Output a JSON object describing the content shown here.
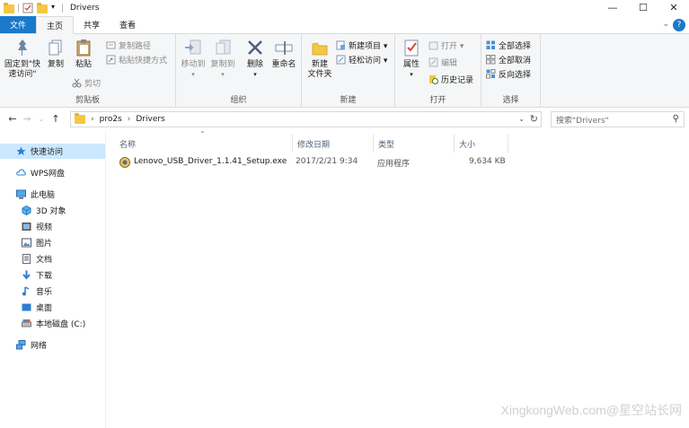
{
  "window": {
    "title": "Drivers",
    "controls": {
      "minimize": "—",
      "maximize": "☐",
      "close": "✕"
    }
  },
  "tabs": [
    {
      "label": "文件",
      "kind": "file"
    },
    {
      "label": "主页",
      "kind": "active"
    },
    {
      "label": "共享",
      "kind": "normal"
    },
    {
      "label": "查看",
      "kind": "normal"
    }
  ],
  "ribbon": {
    "clipboard": {
      "pin": "固定到\"快速访问\"",
      "copy": "复制",
      "paste": "粘贴",
      "copy_path": "复制路径",
      "paste_shortcut": "粘贴快捷方式",
      "cut": "剪切",
      "label": "剪贴板"
    },
    "organize": {
      "move_to": "移动到",
      "copy_to": "复制到",
      "delete": "删除",
      "rename": "重命名",
      "label": "组织"
    },
    "new": {
      "new_folder": "新建\n文件夹",
      "new_item": "新建项目 ▾",
      "easy_access": "轻松访问 ▾",
      "label": "新建"
    },
    "open": {
      "properties": "属性",
      "open": "打开 ▾",
      "edit": "编辑",
      "history": "历史记录",
      "label": "打开"
    },
    "select": {
      "select_all": "全部选择",
      "select_none": "全部取消",
      "invert": "反向选择",
      "label": "选择"
    }
  },
  "address": {
    "crumbs": [
      "pro2s",
      "Drivers"
    ],
    "search_placeholder": "搜索\"Drivers\""
  },
  "nav": {
    "quick_access": "快速访问",
    "wps": "WPS网盘",
    "this_pc": "此电脑",
    "items": [
      "3D 对象",
      "视频",
      "图片",
      "文档",
      "下载",
      "音乐",
      "桌面",
      "本地磁盘 (C:)"
    ],
    "network": "网络"
  },
  "columns": {
    "name": "名称",
    "date": "修改日期",
    "type": "类型",
    "size": "大小"
  },
  "files": [
    {
      "name": "Lenovo_USB_Driver_1.1.41_Setup.exe",
      "date": "2017/2/21 9:34",
      "type": "应用程序",
      "size": "9,634 KB"
    }
  ],
  "watermark": "XingkongWeb.com@星空站长网",
  "colors": {
    "file_tab": "#1979ca",
    "ribbon_bg": "#f5f6f7",
    "selection": "#cce8ff",
    "folder": "#f5c743"
  }
}
